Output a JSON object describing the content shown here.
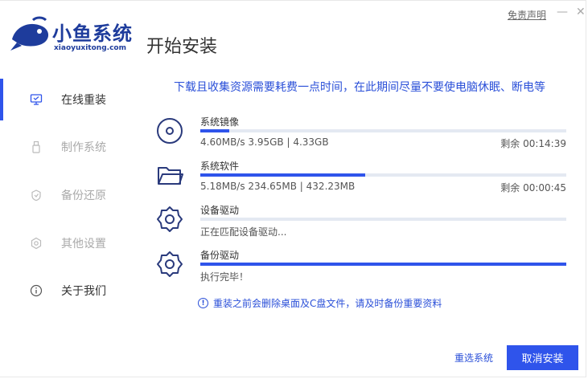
{
  "header": {
    "brand_name": "小鱼系统",
    "brand_domain": "xiaoyuxitong.com",
    "page_title": "开始安装",
    "disclaimer": "免责声明",
    "minimize": "—",
    "close": "✕"
  },
  "sidebar": {
    "items": [
      {
        "label": "在线重装",
        "icon": "monitor-icon",
        "active": true
      },
      {
        "label": "制作系统",
        "icon": "usb-icon",
        "active": false
      },
      {
        "label": "备份还原",
        "icon": "backup-icon",
        "active": false
      },
      {
        "label": "其他设置",
        "icon": "settings-icon",
        "active": false
      },
      {
        "label": "关于我们",
        "icon": "info-icon",
        "active": false
      }
    ]
  },
  "main": {
    "notice": "下载且收集资源需要耗费一点时间，在此期间尽量不要使电脑休眠、断电等",
    "tasks": [
      {
        "name": "系统镜像",
        "icon": "disc-icon",
        "info": "4.60MB/s 3.95GB | 4.33GB",
        "remaining": "剩余 00:14:39",
        "progress": 0.08
      },
      {
        "name": "系统软件",
        "icon": "folder-icon",
        "info": "5.18MB/s 234.65MB | 432.23MB",
        "remaining": "剩余 00:00:45",
        "progress": 0.45
      },
      {
        "name": "设备驱动",
        "icon": "gear-icon",
        "info": "正在匹配设备驱动...",
        "remaining": "",
        "progress": 0
      },
      {
        "name": "备份驱动",
        "icon": "gear-icon",
        "info": "执行完毕！",
        "remaining": "",
        "progress": 1.0
      }
    ],
    "warning": "重装之前会删除桌面及C盘文件，请及时备份重要资料",
    "warning_icon": "!",
    "reselect_button": "重选系统",
    "cancel_button": "取消安装"
  },
  "colors": {
    "accent": "#2f54eb",
    "brand": "#1e3c9c",
    "track": "#e4e9f2"
  }
}
